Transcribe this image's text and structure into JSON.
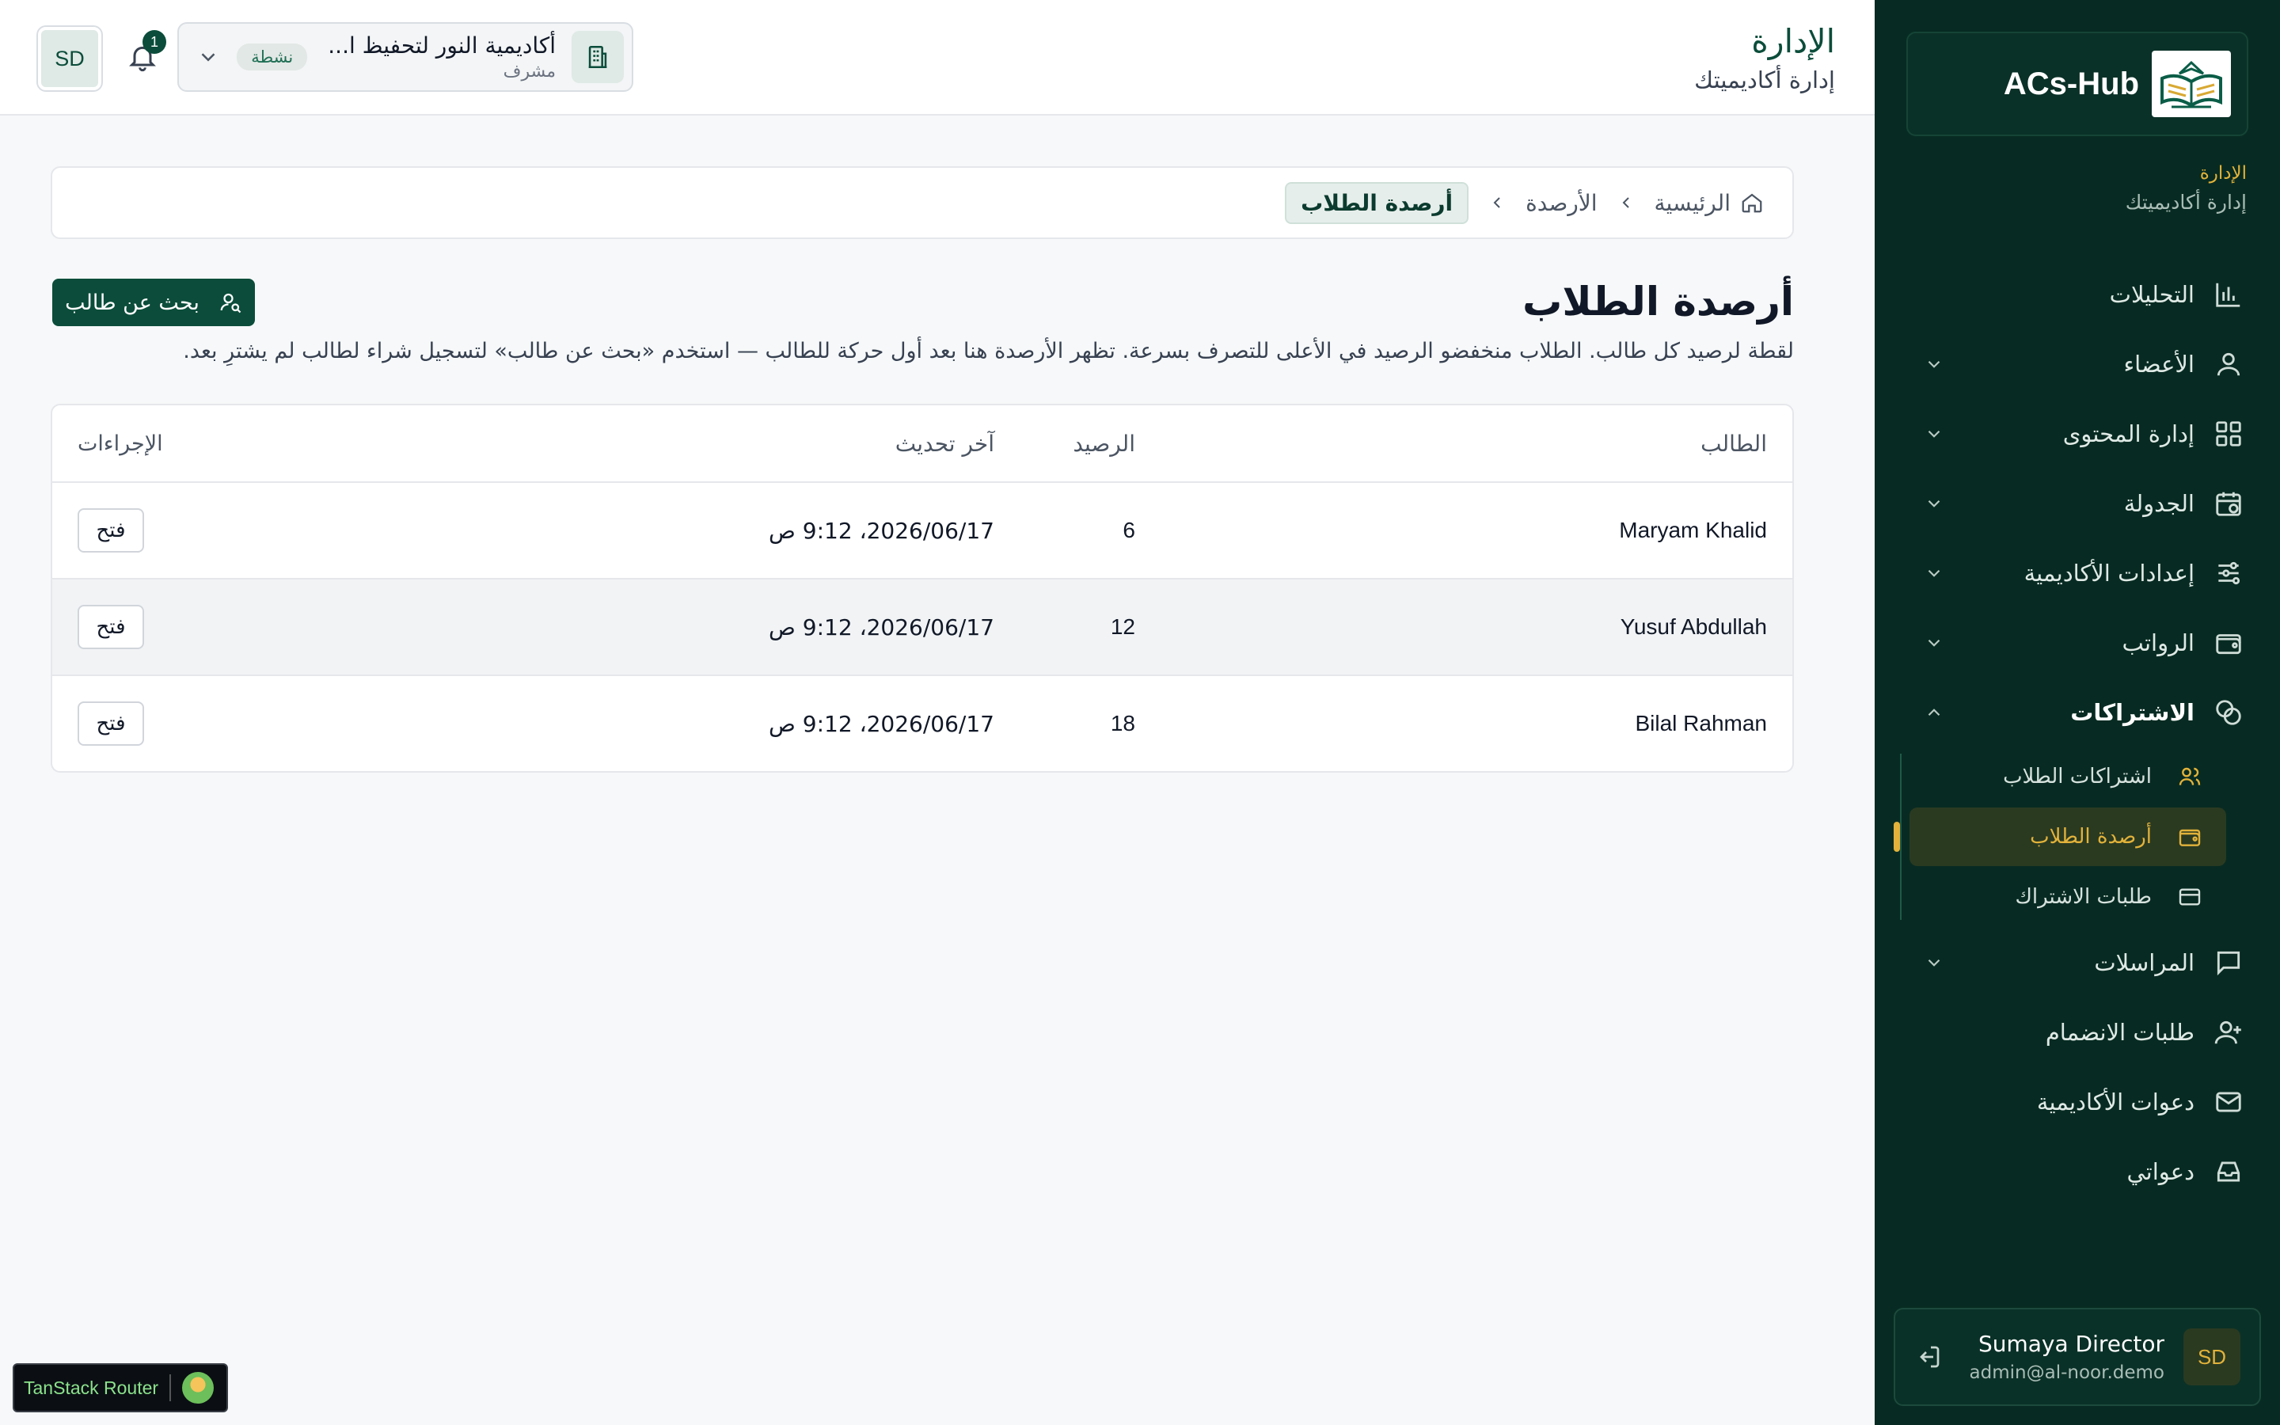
{
  "brand": {
    "name": "ACs-Hub"
  },
  "sidebar": {
    "context_title": "الإدارة",
    "context_sub": "إدارة أكاديميتك",
    "items": [
      {
        "label": "التحليلات",
        "icon": "chart-icon",
        "has_chevron": false
      },
      {
        "label": "الأعضاء",
        "icon": "user-icon",
        "has_chevron": true
      },
      {
        "label": "إدارة المحتوى",
        "icon": "grid-icon",
        "has_chevron": true
      },
      {
        "label": "الجدولة",
        "icon": "calendar-icon",
        "has_chevron": true
      },
      {
        "label": "إعدادات الأكاديمية",
        "icon": "sliders-icon",
        "has_chevron": true
      },
      {
        "label": "الرواتب",
        "icon": "wallet-icon",
        "has_chevron": true
      },
      {
        "label": "الاشتراكات",
        "icon": "coins-icon",
        "has_chevron": true,
        "expanded": true
      },
      {
        "label": "المراسلات",
        "icon": "message-icon",
        "has_chevron": true
      },
      {
        "label": "طلبات الانضمام",
        "icon": "user-plus-icon",
        "has_chevron": false
      },
      {
        "label": "دعوات الأكاديمية",
        "icon": "mail-icon",
        "has_chevron": false
      },
      {
        "label": "دعواتي",
        "icon": "inbox-icon",
        "has_chevron": false
      }
    ],
    "subscriptions_sub": [
      {
        "label": "اشتراكات الطلاب",
        "icon": "users-icon"
      },
      {
        "label": "أرصدة الطلاب",
        "icon": "wallet-icon",
        "active": true
      },
      {
        "label": "طلبات الاشتراك",
        "icon": "card-icon"
      }
    ],
    "user": {
      "initials": "SD",
      "name": "Sumaya Director",
      "email": "admin@al-noor.demo"
    }
  },
  "header": {
    "title": "الإدارة",
    "subtitle": "إدارة أكاديميتك",
    "academy": {
      "name": "أكاديمية النور لتحفيظ ا...",
      "role": "مشرف",
      "status": "نشطة"
    },
    "notifications_count": "1",
    "avatar_initials": "SD"
  },
  "breadcrumb": {
    "home": "الرئيسية",
    "section": "الأرصدة",
    "current": "أرصدة الطلاب"
  },
  "page": {
    "title": "أرصدة الطلاب",
    "description": "لقطة لرصيد كل طالب. الطلاب منخفضو الرصيد في الأعلى للتصرف بسرعة. تظهر الأرصدة هنا بعد أول حركة للطالب — استخدم «بحث عن طالب» لتسجيل شراء لطالب لم يشترِ بعد.",
    "search_button": "بحث عن طالب"
  },
  "table": {
    "headers": {
      "student": "الطالب",
      "balance": "الرصيد",
      "updated": "آخر تحديث",
      "actions": "الإجراءات"
    },
    "rows": [
      {
        "student": "Maryam Khalid",
        "balance": "6",
        "updated": "2026/06/17، 9:12 ص",
        "action": "فتح"
      },
      {
        "student": "Yusuf Abdullah",
        "balance": "12",
        "updated": "2026/06/17، 9:12 ص",
        "action": "فتح"
      },
      {
        "student": "Bilal Rahman",
        "balance": "18",
        "updated": "2026/06/17، 9:12 ص",
        "action": "فتح"
      }
    ]
  },
  "devtools": {
    "label": "TanStack Router"
  },
  "colors": {
    "sidebar_bg": "#072b22",
    "brand_green": "#0b4d3a",
    "accent_gold": "#e2b23a"
  }
}
